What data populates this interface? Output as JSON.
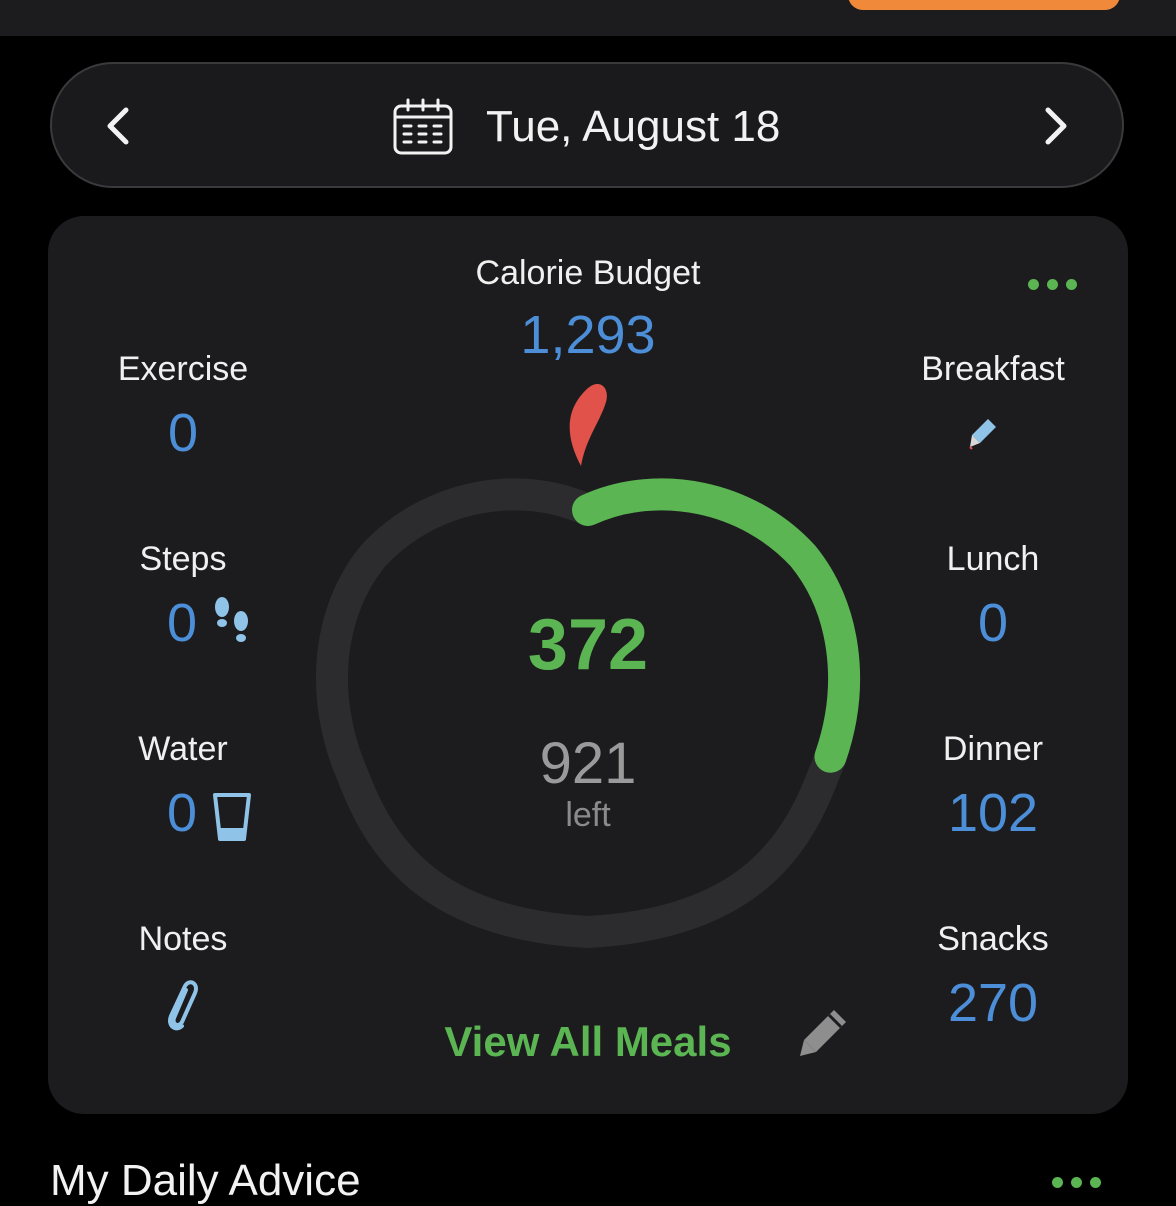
{
  "header": {
    "date": "Tue, August 18"
  },
  "summary": {
    "budget_label": "Calorie Budget",
    "budget_value": "1,293",
    "consumed": "372",
    "left_value": "921",
    "left_label": "left",
    "consumed_fraction": 0.29
  },
  "left_stats": {
    "exercise_label": "Exercise",
    "exercise_value": "0",
    "steps_label": "Steps",
    "steps_value": "0",
    "water_label": "Water",
    "water_value": "0",
    "notes_label": "Notes"
  },
  "meals": {
    "breakfast_label": "Breakfast",
    "lunch_label": "Lunch",
    "lunch_value": "0",
    "dinner_label": "Dinner",
    "dinner_value": "102",
    "snacks_label": "Snacks",
    "snacks_value": "270"
  },
  "actions": {
    "view_all": "View All Meals"
  },
  "advice": {
    "title": "My Daily Advice"
  },
  "colors": {
    "accent_green": "#5ab552",
    "value_blue": "#4c8fd8",
    "stem_red": "#e0524a",
    "ring_track": "#2c2c2e",
    "card_bg": "#1c1c1e",
    "top_accent": "#f08a3a"
  },
  "icons": [
    "chevron-left-icon",
    "calendar-icon",
    "chevron-right-icon",
    "more-icon",
    "pencil-icon",
    "footsteps-icon",
    "water-glass-icon",
    "paperclip-icon",
    "apple-stem-icon"
  ]
}
